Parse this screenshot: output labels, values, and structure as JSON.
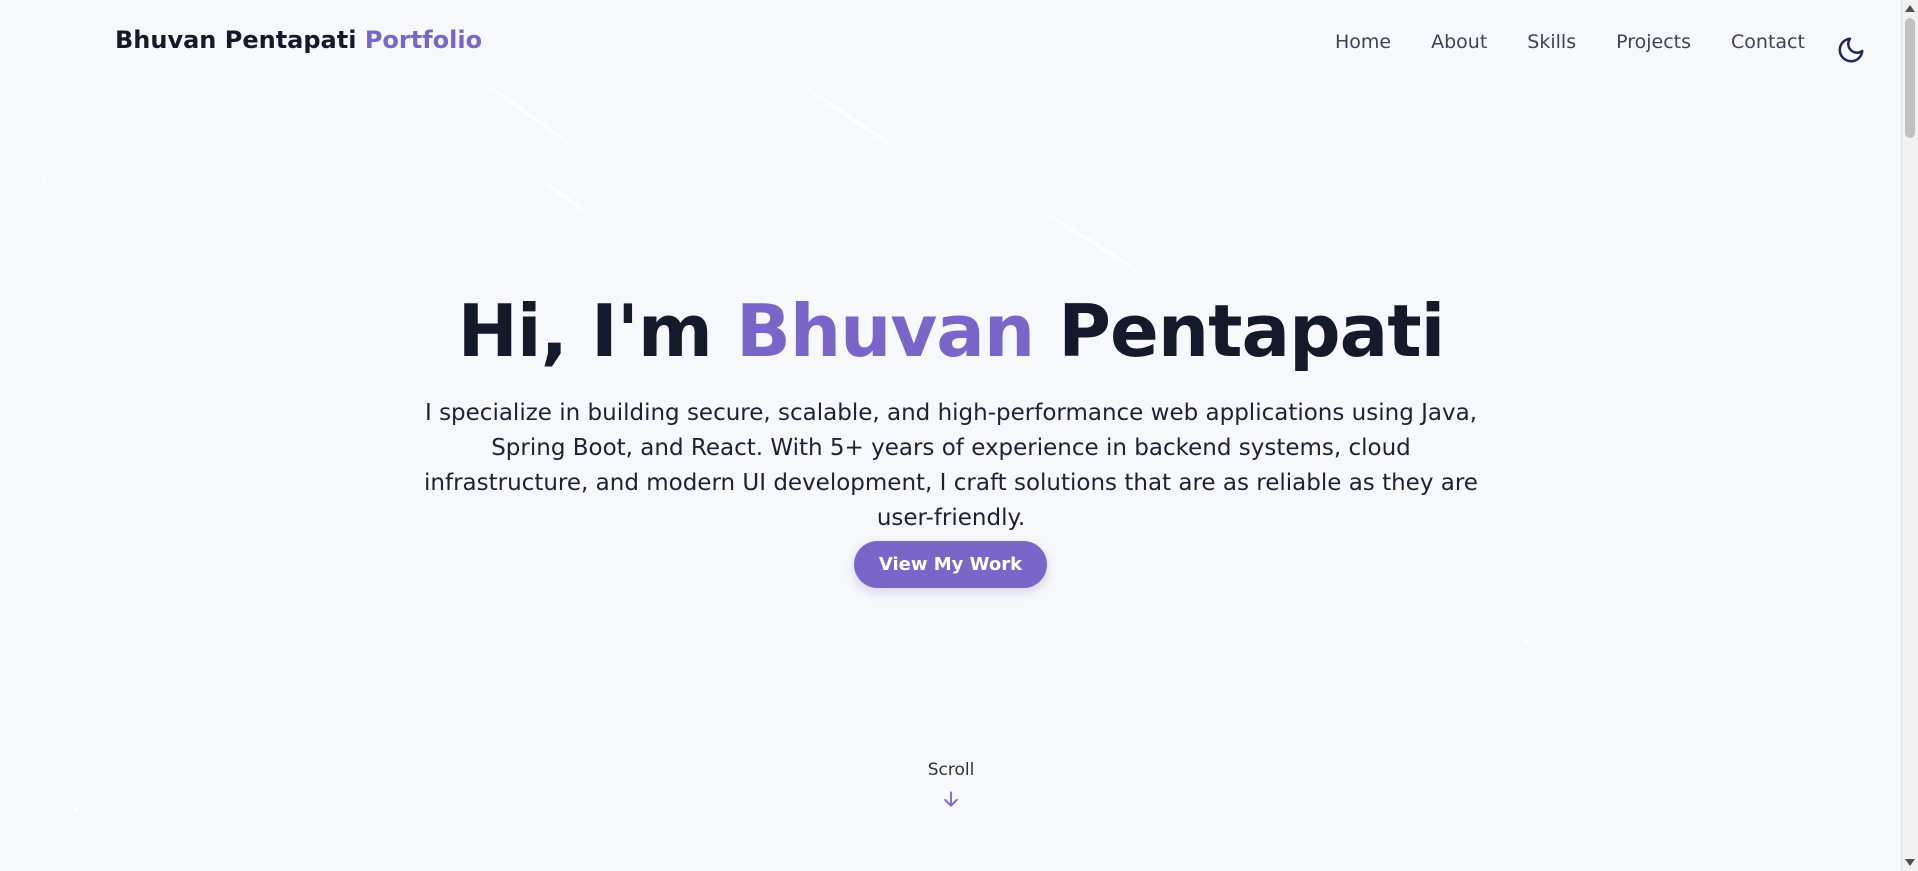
{
  "header": {
    "brand_name": "Bhuvan Pentapati",
    "brand_accent": "Portfolio",
    "nav": [
      "Home",
      "About",
      "Skills",
      "Projects",
      "Contact"
    ],
    "theme_toggle_icon": "moon-icon"
  },
  "hero": {
    "greeting": "Hi, I'm",
    "first_name": "Bhuvan",
    "last_name": "Pentapati",
    "description": "I specialize in building secure, scalable, and high-performance web applications using Java, Spring Boot, and React. With 5+ years of experience in backend systems, cloud infrastructure, and modern UI development, I craft solutions that are as reliable as they are user-friendly.",
    "cta_label": "View My Work",
    "scroll_label": "Scroll",
    "scroll_icon": "arrow-down-icon"
  },
  "colors": {
    "accent": "#7a65c9",
    "text": "#151a2b",
    "background": "#f7f8fb"
  }
}
